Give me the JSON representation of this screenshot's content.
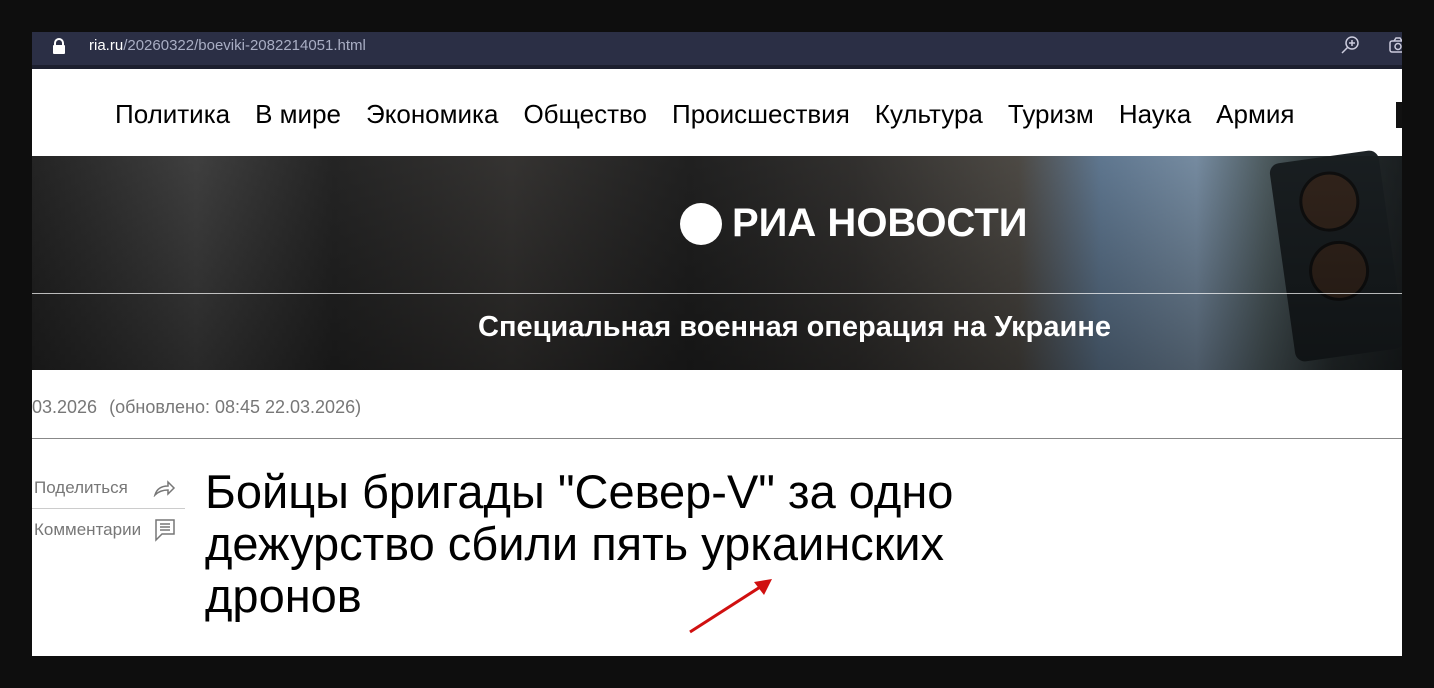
{
  "browser": {
    "url_domain": "ria.ru",
    "url_path": "/20260322/boeviki-2082214051.html",
    "icons": [
      "lock-icon",
      "zoom-in-icon",
      "camera-icon"
    ]
  },
  "nav": {
    "items": [
      "Политика",
      "В мире",
      "Экономика",
      "Общество",
      "Происшествия",
      "Культура",
      "Туризм",
      "Наука",
      "Армия"
    ]
  },
  "hero": {
    "logo": "РИА НОВОСТИ",
    "section": "Специальная военная операция на Украине"
  },
  "article": {
    "published": "03.2026",
    "updated": "(обновлено: 08:45 22.03.2026)",
    "share_label": "Поделиться",
    "comments_label": "Комментарии",
    "title": "Бойцы бригады \"Север-V\" за одно дежурство сбили пять уркаинских дронов"
  },
  "annotation": {
    "color": "#d01010"
  }
}
